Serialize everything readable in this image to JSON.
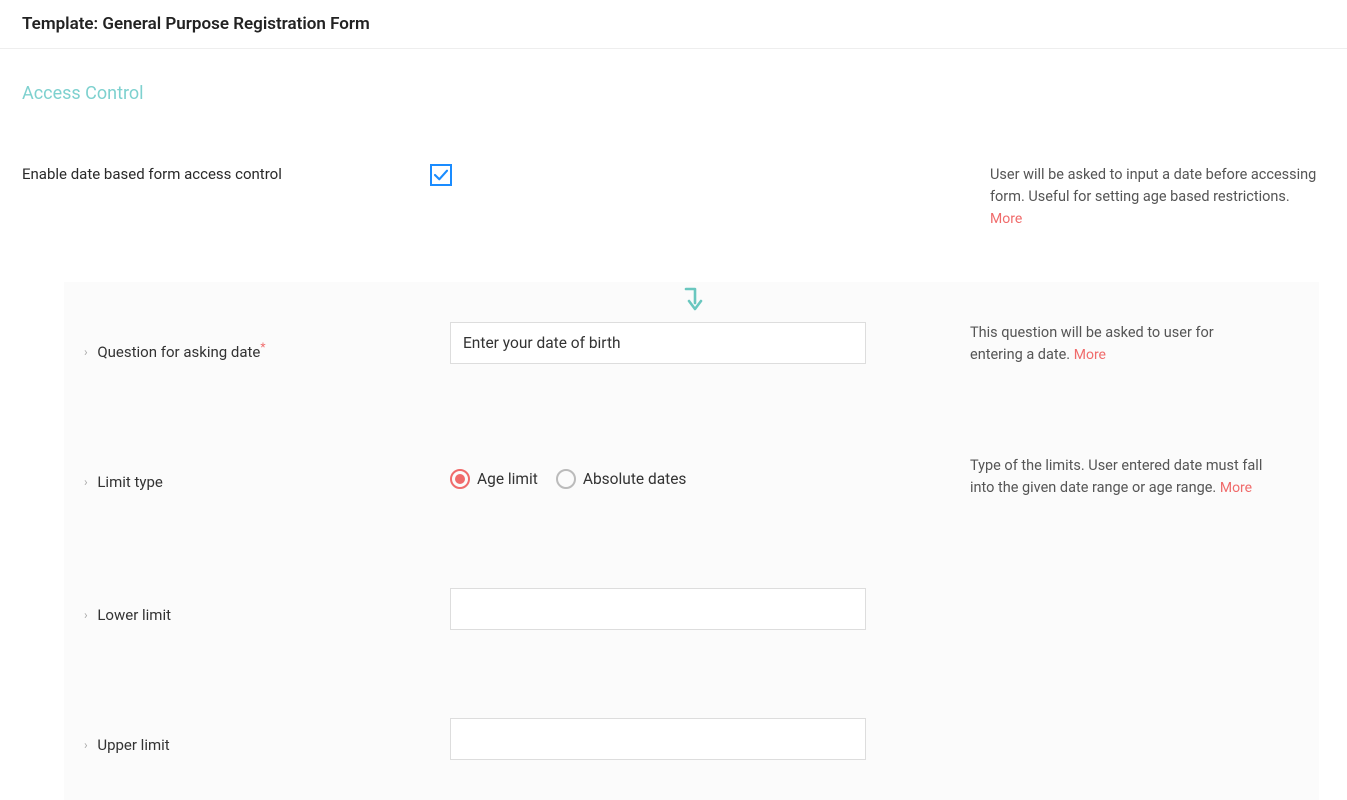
{
  "header": {
    "title": "Template: General Purpose Registration Form"
  },
  "section_title": "Access Control",
  "enable_row": {
    "label": "Enable date based form access control",
    "checked": true,
    "help": "User will be asked to input a date before accessing form. Useful for setting age based restrictions.",
    "more": "More"
  },
  "question_row": {
    "label": "Question for asking date",
    "required_marker": "*",
    "value": "Enter your date of birth",
    "help": "This question will be asked to user for entering a date.",
    "more": "More"
  },
  "limit_type_row": {
    "label": "Limit type",
    "option_age": "Age limit",
    "option_abs": "Absolute dates",
    "selected": "age",
    "help": "Type of the limits. User entered date must fall into the given date range or age range.",
    "more": "More"
  },
  "lower_row": {
    "label": "Lower limit",
    "value": ""
  },
  "upper_row": {
    "label": "Upper limit",
    "value": ""
  }
}
